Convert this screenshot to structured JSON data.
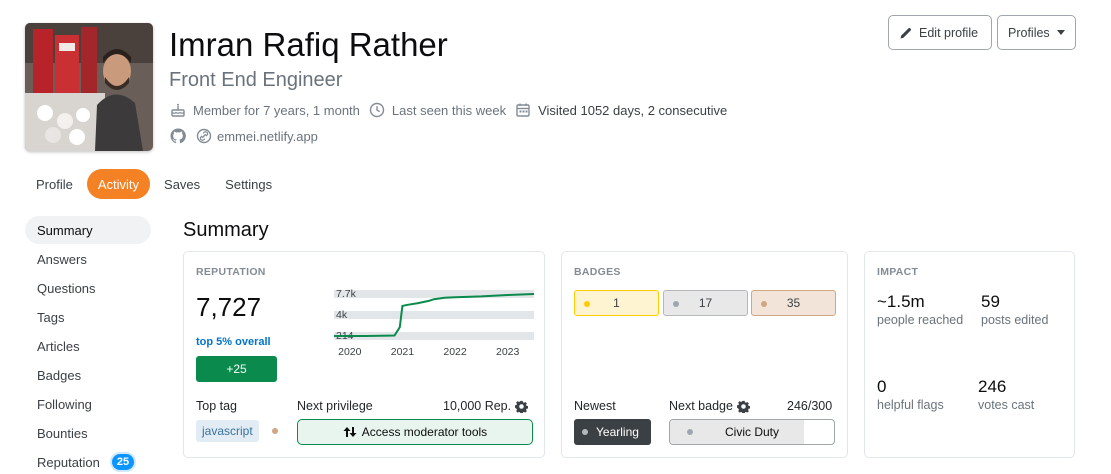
{
  "user": {
    "name": "Imran Rafiq Rather",
    "title": "Front End Engineer",
    "member_for": "Member for 7 years, 1 month",
    "last_seen": "Last seen this week",
    "visited": "Visited 1052 days, 2 consecutive",
    "website": "emmei.netlify.app"
  },
  "actions": {
    "edit_profile": "Edit profile",
    "profiles": "Profiles"
  },
  "tabs": [
    {
      "label": "Profile"
    },
    {
      "label": "Activity"
    },
    {
      "label": "Saves"
    },
    {
      "label": "Settings"
    }
  ],
  "sidebar": {
    "items": [
      {
        "label": "Summary"
      },
      {
        "label": "Answers"
      },
      {
        "label": "Questions"
      },
      {
        "label": "Tags"
      },
      {
        "label": "Articles"
      },
      {
        "label": "Badges"
      },
      {
        "label": "Following"
      },
      {
        "label": "Bounties"
      },
      {
        "label": "Reputation",
        "badge": "25"
      }
    ]
  },
  "summary": {
    "title": "Summary",
    "reputation": {
      "label": "REPUTATION",
      "value": "7,727",
      "rank": "top 5% overall",
      "change": "+25",
      "top_tag_label": "Top tag",
      "top_tag": "javascript",
      "next_privilege_label": "Next privilege",
      "next_privilege_rep": "10,000 Rep.",
      "next_privilege": "Access moderator tools"
    },
    "badges": {
      "label": "BADGES",
      "gold": "1",
      "silver": "17",
      "bronze": "35",
      "newest_label": "Newest",
      "newest": "Yearling",
      "next_badge_label": "Next badge",
      "next_badge_progress": "246/300",
      "next_badge": "Civic Duty",
      "next_badge_fraction": 0.82
    },
    "impact": {
      "label": "IMPACT",
      "people_reached": "~1.5m",
      "people_reached_label": "people reached",
      "posts_edited": "59",
      "posts_edited_label": "posts edited",
      "helpful_flags": "0",
      "helpful_flags_label": "helpful flags",
      "votes_cast": "246",
      "votes_cast_label": "votes cast"
    }
  },
  "colors": {
    "accent": "#f48225",
    "positive": "#0a8a4c",
    "link": "#0074cc",
    "badge_blue": "#0a95ff"
  },
  "chart_data": {
    "type": "line",
    "x_ticks": [
      "2020",
      "2021",
      "2022",
      "2023"
    ],
    "y_ticks": [
      "7.7k",
      "4k",
      "214"
    ],
    "x": [
      2019.7,
      2020.3,
      2020.6,
      2020.85,
      2020.95,
      2021.0,
      2021.1,
      2021.3,
      2021.5,
      2021.6,
      2021.8,
      2022.0,
      2022.5,
      2023.0,
      2023.5
    ],
    "values": [
      214,
      214,
      250,
      300,
      1800,
      5600,
      5800,
      6100,
      6500,
      6800,
      7050,
      7150,
      7300,
      7550,
      7727
    ],
    "ylim": [
      214,
      7727
    ],
    "color": "#0a8a4c"
  }
}
